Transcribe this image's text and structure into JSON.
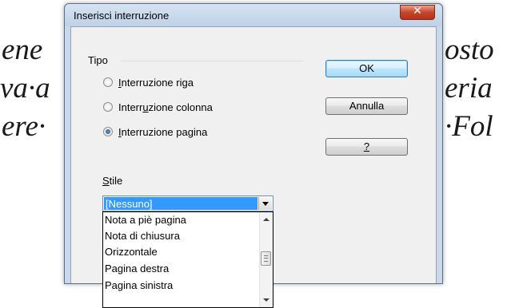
{
  "document": {
    "lines": [
      [
        "ene",
        "osto"
      ],
      [
        "va·a",
        "eria"
      ],
      [
        "ere·",
        "·Fol"
      ]
    ]
  },
  "dialog": {
    "title": "Inserisci interruzione",
    "close_glyph": "✕",
    "group_label": "Tipo",
    "options": [
      {
        "pre": "",
        "mn": "I",
        "post": "nterruzione riga",
        "selected": false
      },
      {
        "pre": "Interr",
        "mn": "u",
        "post": "zione colonna",
        "selected": false
      },
      {
        "pre": "",
        "mn": "I",
        "post": "nterruzione pagina",
        "selected": true
      }
    ],
    "style_label": {
      "mn": "S",
      "post": "tile"
    },
    "style_value": "[Nessuno]",
    "style_options": [
      "Nota a piè pagina",
      "Nota di chiusura",
      "Orizzontale",
      "Pagina destra",
      "Pagina sinistra"
    ],
    "buttons": {
      "ok": "OK",
      "cancel": "Annulla",
      "help": "?"
    }
  },
  "icons": {
    "close": "close-icon",
    "combo_arrow": "chevron-down-icon",
    "scroll_up": "chevron-up-icon",
    "scroll_down": "chevron-down-icon",
    "scroll_grip": "scroll-grip-icon"
  },
  "colors": {
    "selection": "#3399ff",
    "close_button": "#c7452a",
    "frame": "#c9d8ea"
  }
}
